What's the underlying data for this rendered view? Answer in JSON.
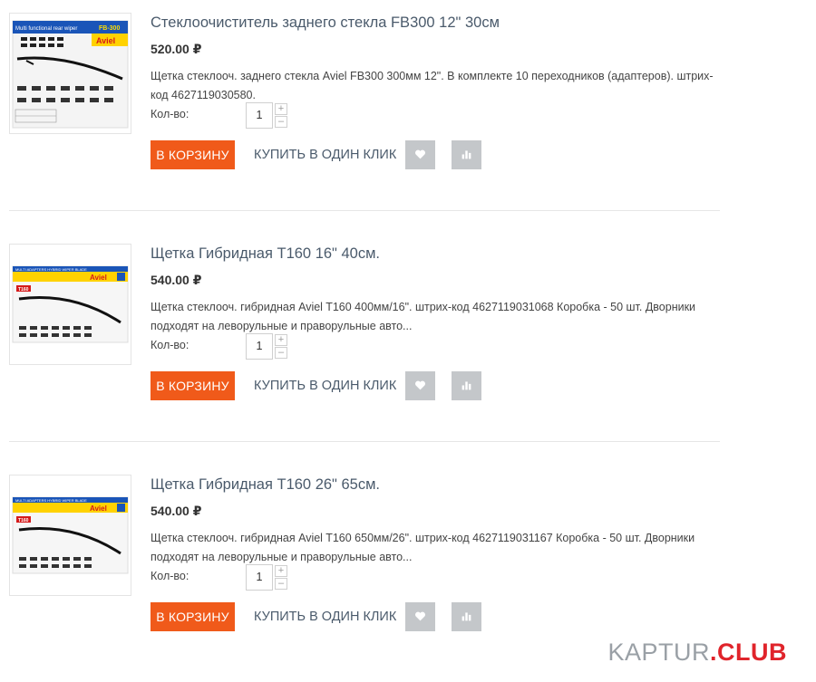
{
  "products": [
    {
      "title": "Стеклоочиститель заднего стекла FB300 12\" 30см",
      "price": "520.00 ₽",
      "description": "Щетка стеклооч. заднего стекла Aviel FB300 300мм 12\". В комплекте 10 переходников (адаптеров). штрих-код 4627119030580.",
      "qty_label": "Кол-во:",
      "qty_value": "1",
      "cart_label": "В КОРЗИНУ",
      "oneclick_label": "КУПИТЬ В ОДИН КЛИК",
      "image": {
        "banner": "Multi functional rear wiper",
        "model": "FB-300",
        "brand": "Aviel"
      }
    },
    {
      "title": "Щетка Гибридная T160 16\" 40см.",
      "price": "540.00 ₽",
      "description": "Щетка стеклооч. гибридная Aviel T160 400мм/16\". штрих-код 4627119031068 Коробка - 50 шт. Дворники подходят на леворульные и праворульные авто...",
      "qty_label": "Кол-во:",
      "qty_value": "1",
      "cart_label": "В КОРЗИНУ",
      "oneclick_label": "КУПИТЬ В ОДИН КЛИК",
      "image": {
        "banner": "MULTI ADAPTERS HYBRID WIPER BLADE",
        "model": "T160",
        "brand": "Aviel"
      }
    },
    {
      "title": "Щетка Гибридная T160 26\" 65см.",
      "price": "540.00 ₽",
      "description": "Щетка стеклооч. гибридная Aviel T160 650мм/26\". штрих-код 4627119031167 Коробка - 50 шт. Дворники подходят на леворульные и праворульные авто...",
      "qty_label": "Кол-во:",
      "qty_value": "1",
      "cart_label": "В КОРЗИНУ",
      "oneclick_label": "КУПИТЬ В ОДИН КЛИК",
      "image": {
        "banner": "MULTI ADAPTERS HYBRID WIPER BLADE",
        "model": "T160",
        "brand": "Aviel"
      }
    }
  ],
  "qty_plus": "+",
  "qty_minus": "–",
  "icons": {
    "favorite": "heart-icon",
    "compare": "bar-chart-icon"
  },
  "colors": {
    "cart": "#f05a1a",
    "icon_button": "#c4c7ca",
    "title": "#4a5a6b",
    "watermark_accent": "#e0242b"
  },
  "watermark": {
    "part1": "KAPTUR",
    "dot": ".",
    "part2": "CLUB"
  }
}
